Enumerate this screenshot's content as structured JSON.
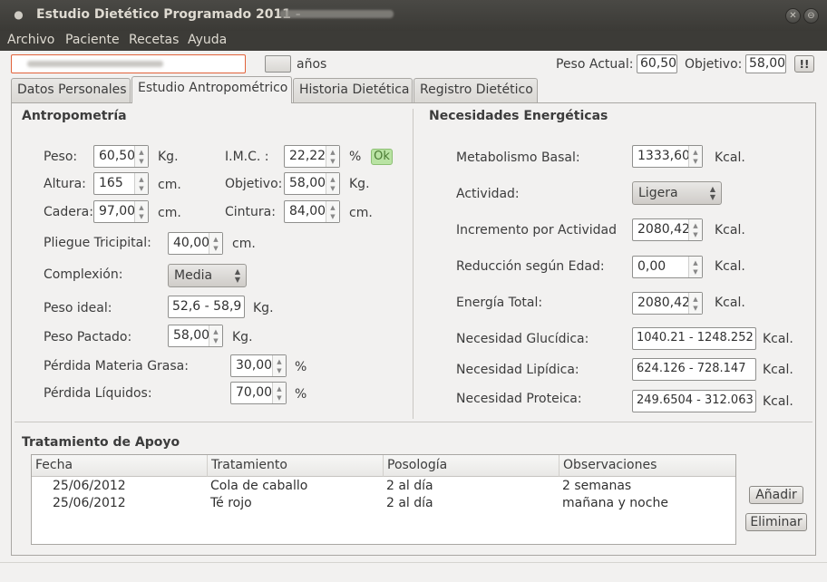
{
  "window": {
    "title": "Estudio Dietético Programado 2011 -"
  },
  "menu": [
    "Archivo",
    "Paciente",
    "Recetas",
    "Ayuda"
  ],
  "topbar": {
    "name_value": "",
    "age_value": "",
    "age_unit": "años",
    "peso_actual_label": "Peso Actual:",
    "peso_actual_value": "60,50",
    "objetivo_label": "Objetivo:",
    "objetivo_value": "58,00",
    "alert_button": "!!"
  },
  "tabs": [
    "Datos Personales",
    "Estudio Antropométrico",
    "Historia Dietética",
    "Registro Dietético"
  ],
  "antropometria": {
    "title": "Antropometría",
    "peso": {
      "label": "Peso:",
      "value": "60,50",
      "unit": "Kg."
    },
    "altura": {
      "label": "Altura:",
      "value": "165",
      "unit": "cm."
    },
    "cadera": {
      "label": "Cadera:",
      "value": "97,00",
      "unit": "cm."
    },
    "imc": {
      "label": "I.M.C. :",
      "value": "22,22",
      "unit": "%",
      "status": "Ok"
    },
    "objetivo": {
      "label": "Objetivo:",
      "value": "58,00",
      "unit": "Kg."
    },
    "cintura": {
      "label": "Cintura:",
      "value": "84,00",
      "unit": "cm."
    },
    "pliegue": {
      "label": "Pliegue Tricipital:",
      "value": "40,00",
      "unit": "cm."
    },
    "complexion": {
      "label": "Complexión:",
      "value": "Media"
    },
    "peso_ideal": {
      "label": "Peso ideal:",
      "value": "52,6 - 58,9",
      "unit": "Kg."
    },
    "peso_pactado": {
      "label": "Peso Pactado:",
      "value": "58,00",
      "unit": "Kg."
    },
    "perdida_grasa": {
      "label": "Pérdida Materia Grasa:",
      "value": "30,00",
      "unit": "%"
    },
    "perdida_liquidos": {
      "label": "Pérdida Líquidos:",
      "value": "70,00",
      "unit": "%"
    }
  },
  "necesidades": {
    "title": "Necesidades Energéticas",
    "metabolismo": {
      "label": "Metabolismo Basal:",
      "value": "1333,60",
      "unit": "Kcal."
    },
    "actividad": {
      "label": "Actividad:",
      "value": "Ligera"
    },
    "incremento": {
      "label": "Incremento por Actividad",
      "value": "2080,42",
      "unit": "Kcal."
    },
    "reduccion": {
      "label": "Reducción según Edad:",
      "value": "0,00",
      "unit": "Kcal."
    },
    "energia": {
      "label": "Energía Total:",
      "value": "2080,42",
      "unit": "Kcal."
    },
    "glucidica": {
      "label": "Necesidad Glucídica:",
      "value": "1040.21 - 1248.252",
      "unit": "Kcal."
    },
    "lipidica": {
      "label": "Necesidad Lipídica:",
      "value": "624.126 - 728.147",
      "unit": "Kcal."
    },
    "proteica": {
      "label": "Necesidad Proteica:",
      "value": "249.6504 - 312.063",
      "unit": "Kcal."
    }
  },
  "tratamiento": {
    "title": "Tratamiento de Apoyo",
    "columns": [
      "Fecha",
      "Tratamiento",
      "Posología",
      "Observaciones"
    ],
    "rows": [
      [
        "25/06/2012",
        "Cola de caballo",
        "2 al día",
        "2 semanas"
      ],
      [
        "25/06/2012",
        "Té rojo",
        "2 al día",
        "mañana y noche"
      ]
    ],
    "add_button": "Añadir",
    "delete_button": "Eliminar"
  },
  "colors": {
    "ok_badge": "#b9e3a3",
    "name_border": "#e2623a",
    "titlebar": "#3c3b37"
  }
}
